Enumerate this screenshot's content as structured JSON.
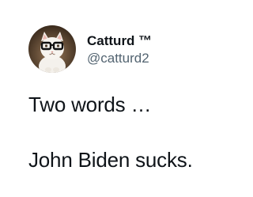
{
  "tweet": {
    "author": {
      "display_name": "Catturd ™",
      "handle": "@catturd2",
      "avatar_icon": "cat-with-glasses-avatar"
    },
    "text_lines": [
      "Two words …",
      "John Biden sucks."
    ]
  },
  "colors": {
    "text": "#0f1419",
    "handle": "#536471",
    "background": "#ffffff"
  }
}
